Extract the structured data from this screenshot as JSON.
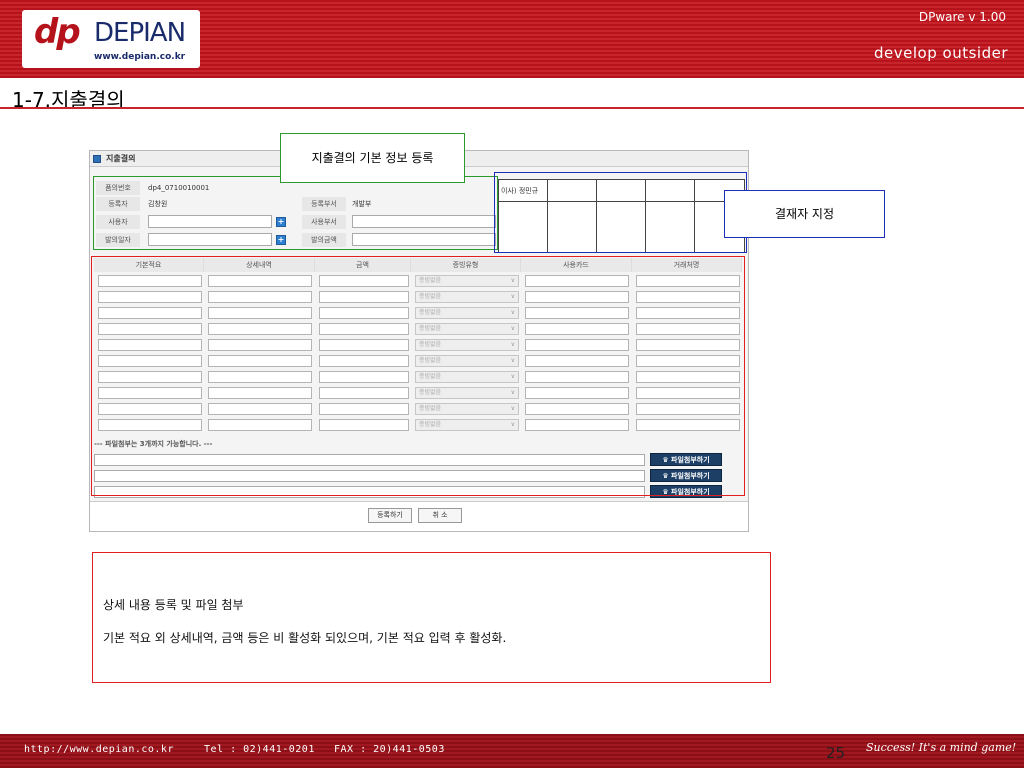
{
  "header": {
    "logo_mark": "dp",
    "logo_name": "DEPIAN",
    "logo_url": "www.depian.co.kr",
    "version": "DPware v 1.00",
    "tagline": "develop outsider"
  },
  "slide": {
    "title": "1-7.지출결의"
  },
  "form": {
    "window_title": "지출결의",
    "fields": {
      "doc_no_label": "품의번호",
      "doc_no_value": "dp4_0710010001",
      "writer_label": "등록자",
      "writer_value": "김창원",
      "dept_label": "등록부서",
      "dept_value": "개발부",
      "user_label": "사용자",
      "user_value": "",
      "use_dept_label": "사용부서",
      "use_dept_value": "",
      "date_label": "발의일자",
      "date_value": "",
      "amount_label": "발의금액",
      "amount_value": ""
    },
    "approval": {
      "first_approver": "이사) 정민규"
    },
    "table": {
      "headers": [
        "기본적요",
        "상세내역",
        "금액",
        "증빙유형",
        "사용카드",
        "거래처명"
      ],
      "select_placeholder": "증빙없음",
      "row_count": 10
    },
    "attach": {
      "note": "--- 파일첨부는 3개까지 가능합니다. ---",
      "button_label": "파일첨부하기"
    },
    "buttons": {
      "submit": "등록하기",
      "cancel": "취 소"
    }
  },
  "callouts": {
    "basic_info": "지출결의 기본 정보 등록",
    "approver": "결재자 지정"
  },
  "description": {
    "line1": "상세 내용 등록 및 파일 첨부",
    "line2": "기본 적요 외 상세내역, 금액 등은 비 활성화 되있으며, 기본 적요 입력 후 활성화."
  },
  "footer": {
    "url": "http://www.depian.co.kr",
    "tel": "Tel : 02)441-0201",
    "fax": "FAX : 20)441-0503",
    "page": "25",
    "slogan": "Success! It's a mind game!"
  },
  "colors": {
    "brand_red": "#c8242c",
    "highlight_green": "#2a9a2a",
    "highlight_blue": "#1b2fb8",
    "highlight_red": "#e02020"
  }
}
